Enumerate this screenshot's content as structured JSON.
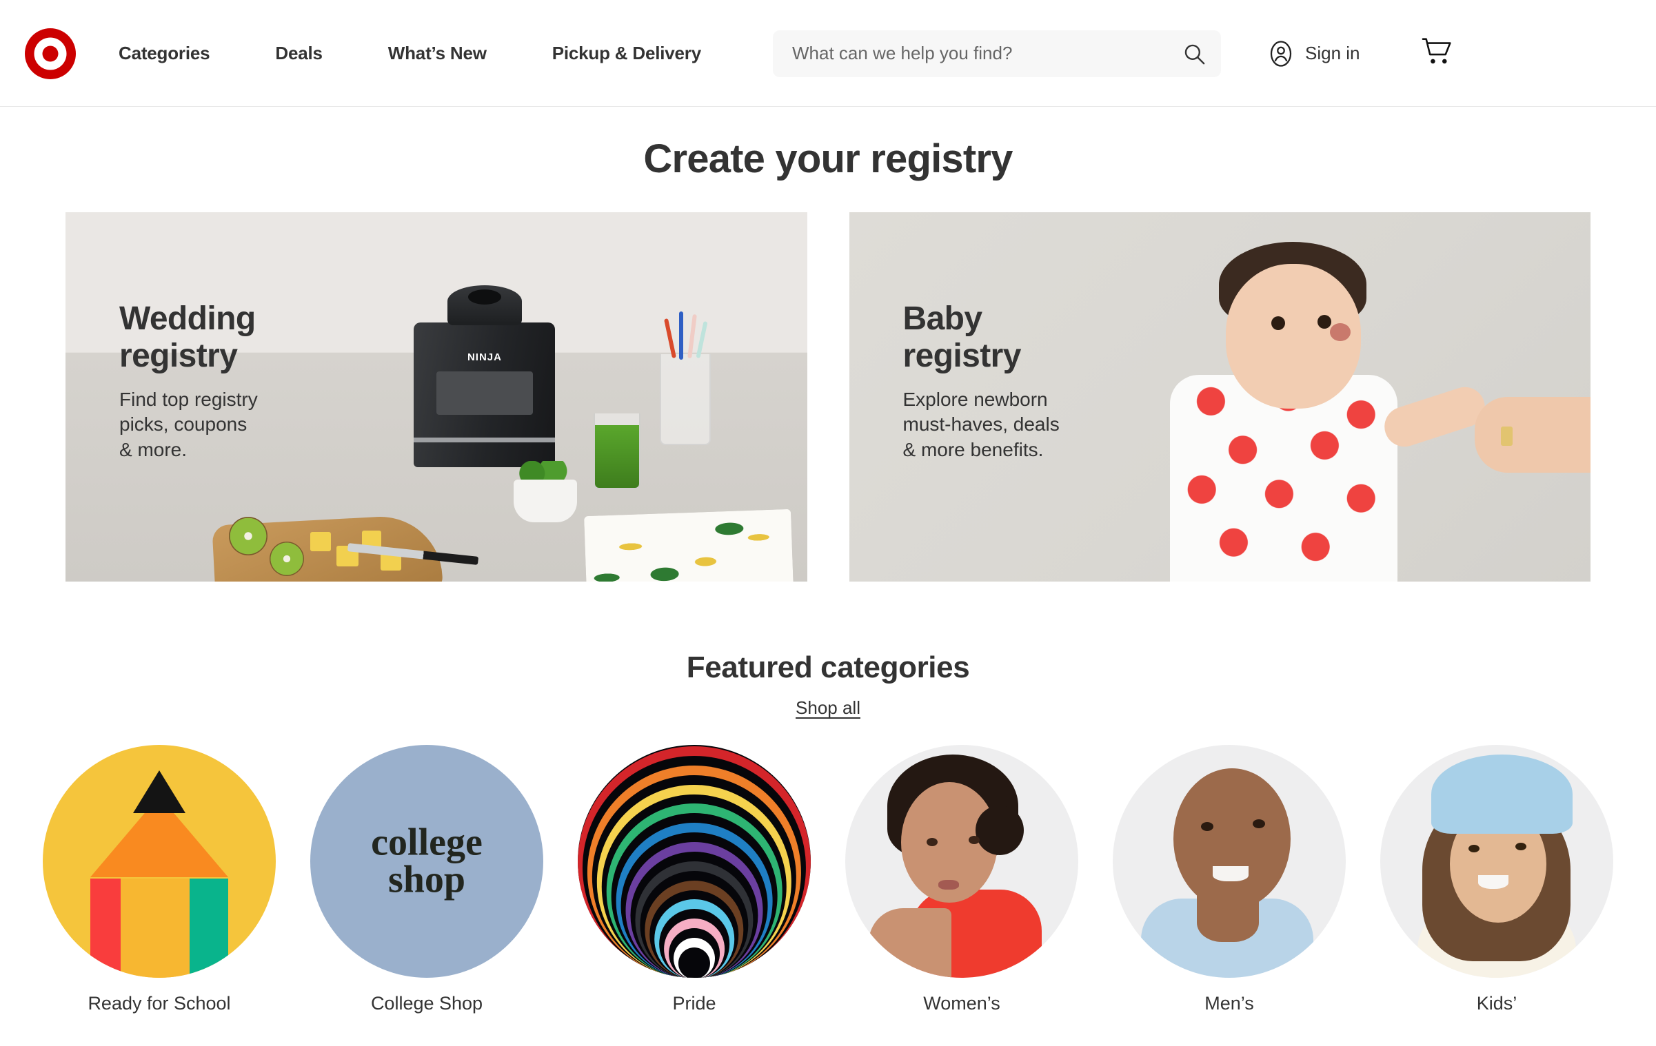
{
  "header": {
    "logo_name": "target-bullseye-logo",
    "nav": [
      {
        "label": "Categories"
      },
      {
        "label": "Deals"
      },
      {
        "label": "What’s New"
      },
      {
        "label": "Pickup & Delivery"
      }
    ],
    "search": {
      "placeholder": "What can we help you find?",
      "value": "",
      "icon": "search-icon"
    },
    "account": {
      "label": "Sign in",
      "icon": "user-circle-icon"
    },
    "cart": {
      "icon": "shopping-cart-icon"
    }
  },
  "page": {
    "title": "Create your registry"
  },
  "registry_cards": [
    {
      "title": "Wedding\nregistry",
      "subtitle": "Find top registry\npicks, coupons\n& more.",
      "image_alt": "ninja-blender-kitchen-scene",
      "brand_on_product": "NINJA",
      "bg_color": "#e6e3df"
    },
    {
      "title": "Baby\nregistry",
      "subtitle": "Explore newborn\nmust-haves, deals\n& more benefits.",
      "image_alt": "baby-in-red-polka-dot-onesie-holding-adult-hand",
      "bg_color": "#dbd9d4"
    }
  ],
  "featured": {
    "title": "Featured categories",
    "shop_all_label": "Shop all",
    "categories": [
      {
        "label": "Ready for School",
        "icon": "pencil-icon",
        "bg": "#f5c53c"
      },
      {
        "label": "College Shop",
        "icon": "college-shop-logo",
        "logo_text": "college\nshop",
        "bg": "#9ab0cc"
      },
      {
        "label": "Pride",
        "icon": "pride-rainbow-arcs",
        "bg": "#06060a",
        "arc_colors": [
          "#d4252a",
          "#ef7f29",
          "#f5d24e",
          "#2eb573",
          "#1f7fc4",
          "#6b3fa0",
          "#2f3136",
          "#6b3f22",
          "#5bc8e8",
          "#f6aec4",
          "#ffffff"
        ]
      },
      {
        "label": "Women’s",
        "icon": "woman-model-photo",
        "bg": "#eeeeef"
      },
      {
        "label": "Men’s",
        "icon": "man-model-photo",
        "bg": "#eeeeef"
      },
      {
        "label": "Kids’",
        "icon": "girl-model-photo",
        "bg": "#efefef"
      }
    ]
  },
  "colors": {
    "brand_red": "#cc0000",
    "text": "#333333",
    "search_bg": "#f7f7f7"
  }
}
